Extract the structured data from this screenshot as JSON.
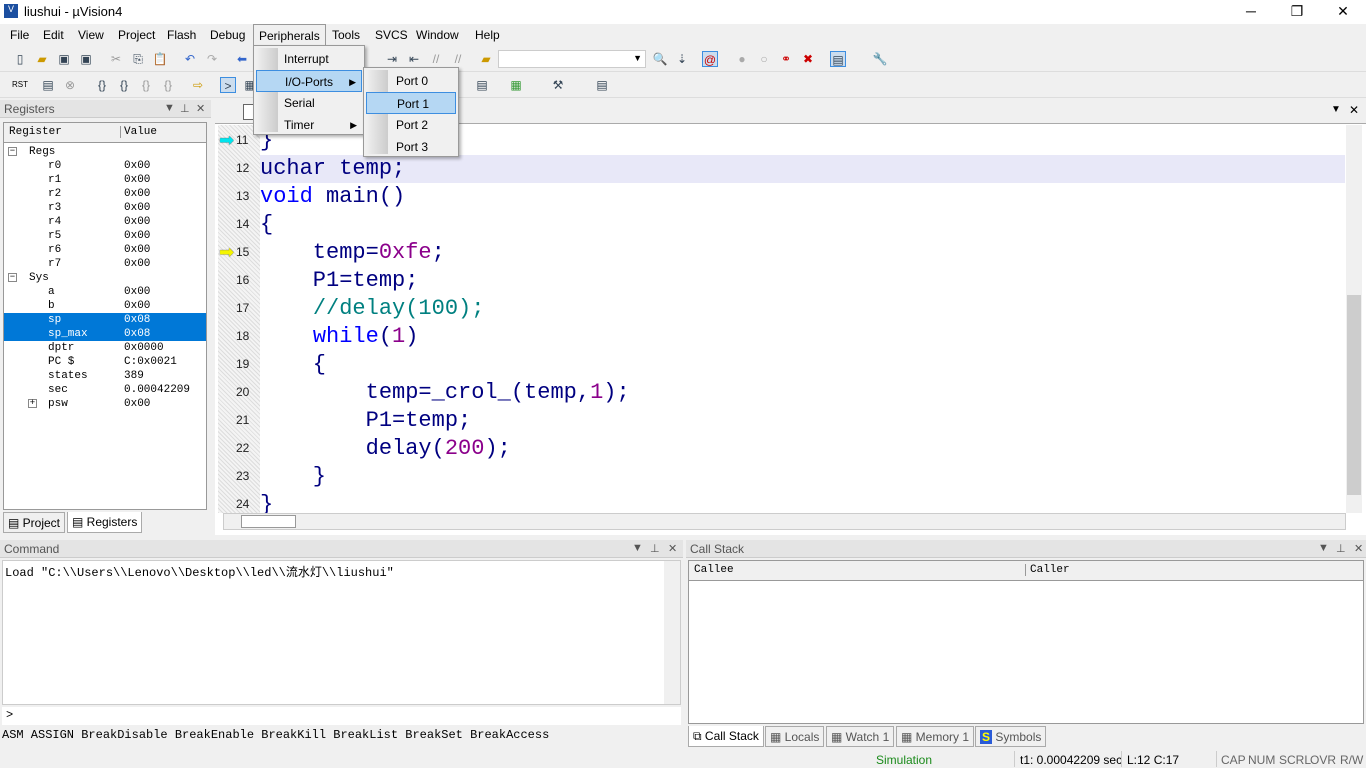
{
  "window": {
    "title": "liushui  - µVision4",
    "minimize": "─",
    "maximize": "❐",
    "close": "✕"
  },
  "menubar": [
    "File",
    "Edit",
    "View",
    "Project",
    "Flash",
    "Debug",
    "Peripherals",
    "Tools",
    "SVCS",
    "Window",
    "Help"
  ],
  "peripherals_menu": {
    "items": [
      "Interrupt",
      "I/O-Ports",
      "Serial",
      "Timer"
    ],
    "highlighted": "I/O-Ports"
  },
  "io_ports_submenu": {
    "items": [
      "Port 0",
      "Port 1",
      "Port 2",
      "Port 3"
    ],
    "highlighted": "Port 1"
  },
  "registers": {
    "title": "Registers",
    "columns": [
      "Register",
      "Value"
    ],
    "rows": [
      {
        "name": "Regs",
        "value": "",
        "level": 0,
        "expander": "−"
      },
      {
        "name": "r0",
        "value": "0x00",
        "level": 1
      },
      {
        "name": "r1",
        "value": "0x00",
        "level": 1
      },
      {
        "name": "r2",
        "value": "0x00",
        "level": 1
      },
      {
        "name": "r3",
        "value": "0x00",
        "level": 1
      },
      {
        "name": "r4",
        "value": "0x00",
        "level": 1
      },
      {
        "name": "r5",
        "value": "0x00",
        "level": 1
      },
      {
        "name": "r6",
        "value": "0x00",
        "level": 1
      },
      {
        "name": "r7",
        "value": "0x00",
        "level": 1
      },
      {
        "name": "Sys",
        "value": "",
        "level": 0,
        "expander": "−"
      },
      {
        "name": "a",
        "value": "0x00",
        "level": 1
      },
      {
        "name": "b",
        "value": "0x00",
        "level": 1
      },
      {
        "name": "sp",
        "value": "0x08",
        "level": 1,
        "selected": true
      },
      {
        "name": " sp_max",
        "value": "0x08",
        "level": 1,
        "selected": true
      },
      {
        "name": "dptr",
        "value": "0x0000",
        "level": 1
      },
      {
        "name": "PC  $",
        "value": "C:0x0021",
        "level": 1
      },
      {
        "name": "states",
        "value": "389",
        "level": 1
      },
      {
        "name": "sec",
        "value": "0.00042209",
        "level": 1
      },
      {
        "name": "psw",
        "value": "0x00",
        "level": 1,
        "expander": "+"
      }
    ],
    "tabs": [
      "Project",
      "Registers"
    ]
  },
  "editor": {
    "lines": [
      {
        "n": "11",
        "marker": "cyan-arrow",
        "html": "<span>}</span>"
      },
      {
        "n": "12",
        "current": true,
        "html": "uchar temp;"
      },
      {
        "n": "13",
        "html": "<span class='kw'>void</span> main()"
      },
      {
        "n": "14",
        "html": "{"
      },
      {
        "n": "15",
        "marker": "yellow-arrow",
        "html": "    temp=<span class='nm'>0xfe</span>;"
      },
      {
        "n": "16",
        "html": "    P1=temp;"
      },
      {
        "n": "17",
        "html": "    <span class='cm'>//delay(100);</span>"
      },
      {
        "n": "18",
        "html": "    <span class='kw'>while</span>(<span class='nm'>1</span>)"
      },
      {
        "n": "19",
        "html": "    {"
      },
      {
        "n": "20",
        "html": "        temp=_crol_(temp,<span class='nm'>1</span>);"
      },
      {
        "n": "21",
        "html": "        P1=temp;"
      },
      {
        "n": "22",
        "html": "        delay(<span class='nm'>200</span>);"
      },
      {
        "n": "23",
        "html": "    }"
      },
      {
        "n": "24",
        "html": "}"
      }
    ]
  },
  "command": {
    "title": "Command",
    "output": "Load \"C:\\\\Users\\\\Lenovo\\\\Desktop\\\\led\\\\流水灯\\\\liushui\"",
    "prompt": ">",
    "commands": "ASM ASSIGN BreakDisable BreakEnable BreakKill BreakList BreakSet BreakAccess"
  },
  "callstack": {
    "title": "Call Stack",
    "columns": [
      "Callee",
      "Caller"
    ],
    "tabs": [
      "Call Stack",
      "Locals",
      "Watch 1",
      "Memory 1",
      "Symbols"
    ]
  },
  "status": {
    "mode": "Simulation",
    "time": "t1: 0.00042209 sec",
    "pos": "L:12 C:17",
    "flags": [
      "CAP",
      "NUM",
      "SCRL",
      "OVR",
      "R/W"
    ]
  },
  "colors": {
    "selection": "#0078d7",
    "menu_highlight": "#b5d7f3",
    "status_mode": "#1a8a1a",
    "keyword": "#0000ff",
    "number": "#8b008b",
    "comment": "#008080"
  }
}
